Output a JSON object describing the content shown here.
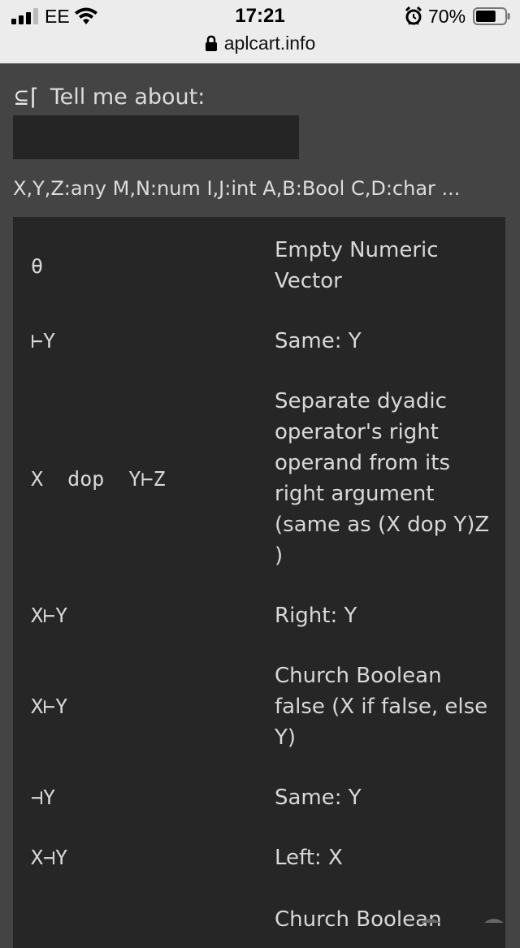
{
  "status_bar": {
    "carrier": "EE",
    "time": "17:21",
    "battery_percent": "70%",
    "battery_level": 0.7
  },
  "url_bar": {
    "domain": "aplcart.info"
  },
  "page": {
    "logo": "⊆⌈",
    "prompt": "Tell me about:",
    "search_value": "",
    "legend": "X,Y,Z:any M,N:num I,J:int A,B:Bool C,D:char ..."
  },
  "results": [
    {
      "expr": "θ",
      "desc": "Empty Numeric Vector"
    },
    {
      "expr": "⊢Y",
      "desc": "Same: Y"
    },
    {
      "expr": "X  dop  Y⊢Z",
      "desc": "Separate dyadic operator's right operand from its right argument (same as (X dop Y)Z )"
    },
    {
      "expr": "X⊢Y",
      "desc": "Right: Y"
    },
    {
      "expr": "X⊢Y",
      "desc": "Church Boolean false (X if false, else Y)"
    },
    {
      "expr": "⊣Y",
      "desc": "Same: Y"
    },
    {
      "expr": "X⊣Y",
      "desc": "Left: X"
    },
    {
      "expr": "",
      "desc": "Church Boolean"
    }
  ]
}
